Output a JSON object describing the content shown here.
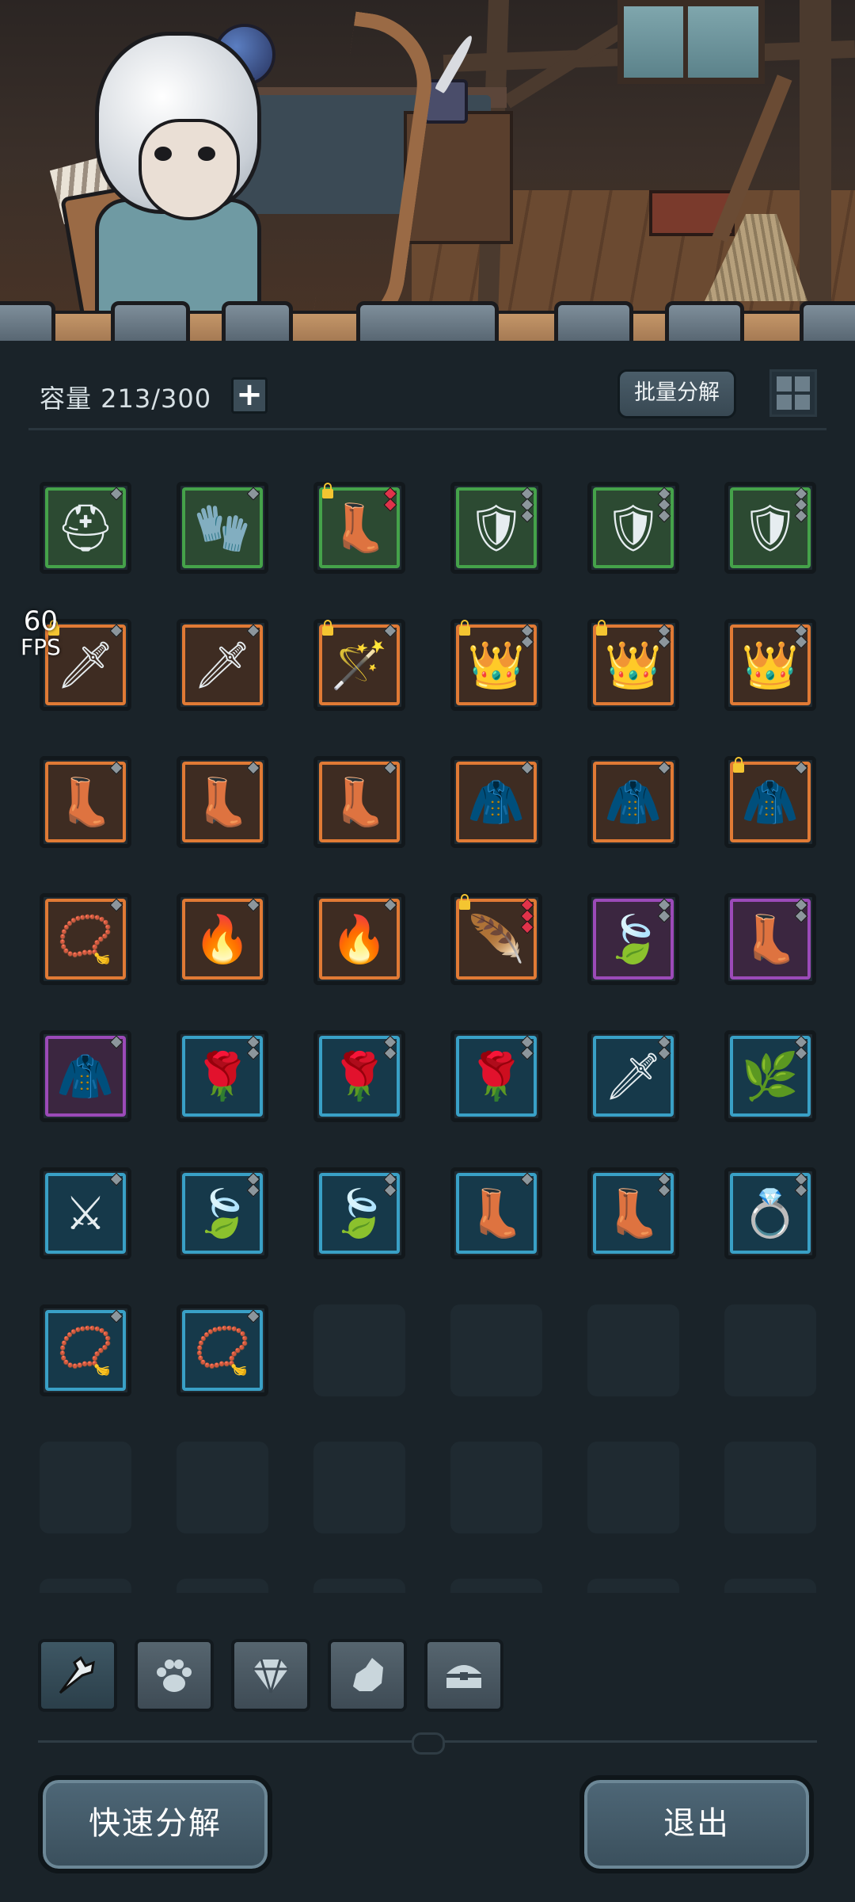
{
  "header": {
    "capacity_label": "容量 213/300",
    "add_capacity_label": "+",
    "batch_decompose_label": "批量分解"
  },
  "fps": {
    "value": "60",
    "label": "FPS"
  },
  "inventory": {
    "columns": 6,
    "items": [
      {
        "name": "white-helmet",
        "quality": "green",
        "icon": "⛑",
        "locked": false,
        "gems": [
          "gray"
        ]
      },
      {
        "name": "purple-gauntlet",
        "quality": "green",
        "icon": "🧤",
        "locked": false,
        "gems": [
          "gray"
        ]
      },
      {
        "name": "purple-boots",
        "quality": "green",
        "icon": "👢",
        "locked": true,
        "gems": [
          "red",
          "red"
        ]
      },
      {
        "name": "purple-armor",
        "quality": "green",
        "icon": "🛡",
        "locked": false,
        "gems": [
          "gray",
          "gray",
          "gray"
        ]
      },
      {
        "name": "purple-armor",
        "quality": "green",
        "icon": "🛡",
        "locked": false,
        "gems": [
          "gray",
          "gray",
          "gray"
        ]
      },
      {
        "name": "purple-armor",
        "quality": "green",
        "icon": "🛡",
        "locked": false,
        "gems": [
          "gray",
          "gray",
          "gray"
        ]
      },
      {
        "name": "crystal-sword",
        "quality": "orange",
        "icon": "🗡",
        "locked": true,
        "gems": [
          "gray"
        ]
      },
      {
        "name": "crystal-sword",
        "quality": "orange",
        "icon": "🗡",
        "locked": false,
        "gems": [
          "gray"
        ]
      },
      {
        "name": "feather-staff",
        "quality": "orange",
        "icon": "🪄",
        "locked": true,
        "gems": [
          "gray"
        ]
      },
      {
        "name": "gold-helmet",
        "quality": "orange",
        "icon": "👑",
        "locked": true,
        "gems": [
          "gray",
          "gray"
        ]
      },
      {
        "name": "gold-helmet",
        "quality": "orange",
        "icon": "👑",
        "locked": true,
        "gems": [
          "gray",
          "gray"
        ]
      },
      {
        "name": "gold-helmet",
        "quality": "orange",
        "icon": "👑",
        "locked": false,
        "gems": [
          "gray",
          "gray"
        ]
      },
      {
        "name": "green-boots",
        "quality": "orange",
        "icon": "👢",
        "locked": false,
        "gems": [
          "gray"
        ]
      },
      {
        "name": "green-boots",
        "quality": "orange",
        "icon": "👢",
        "locked": false,
        "gems": [
          "gray"
        ]
      },
      {
        "name": "green-boots",
        "quality": "orange",
        "icon": "👢",
        "locked": false,
        "gems": [
          "gray"
        ]
      },
      {
        "name": "brown-armor",
        "quality": "orange",
        "icon": "🧥",
        "locked": false,
        "gems": [
          "gray"
        ]
      },
      {
        "name": "brown-armor",
        "quality": "orange",
        "icon": "🧥",
        "locked": false,
        "gems": [
          "gray"
        ]
      },
      {
        "name": "brown-armor",
        "quality": "orange",
        "icon": "🧥",
        "locked": true,
        "gems": [
          "gray"
        ]
      },
      {
        "name": "gold-necklace",
        "quality": "orange",
        "icon": "📿",
        "locked": false,
        "gems": [
          "gray"
        ]
      },
      {
        "name": "flame-amulet",
        "quality": "orange",
        "icon": "🔥",
        "locked": false,
        "gems": [
          "gray"
        ]
      },
      {
        "name": "flame-amulet",
        "quality": "orange",
        "icon": "🔥",
        "locked": false,
        "gems": [
          "gray"
        ]
      },
      {
        "name": "winged-staff",
        "quality": "orange",
        "icon": "🪶",
        "locked": true,
        "gems": [
          "red",
          "red",
          "red"
        ]
      },
      {
        "name": "leaf-gloves",
        "quality": "purple",
        "icon": "🍃",
        "locked": false,
        "gems": [
          "gray",
          "gray"
        ]
      },
      {
        "name": "leather-boots",
        "quality": "purple",
        "icon": "👢",
        "locked": false,
        "gems": [
          "gray",
          "gray"
        ]
      },
      {
        "name": "leaf-armor",
        "quality": "purple",
        "icon": "🧥",
        "locked": false,
        "gems": [
          "gray"
        ]
      },
      {
        "name": "thorn-staff",
        "quality": "blue",
        "icon": "🌹",
        "locked": false,
        "gems": [
          "gray",
          "gray"
        ]
      },
      {
        "name": "thorn-staff",
        "quality": "blue",
        "icon": "🌹",
        "locked": false,
        "gems": [
          "gray",
          "gray"
        ]
      },
      {
        "name": "thorn-staff",
        "quality": "blue",
        "icon": "🌹",
        "locked": false,
        "gems": [
          "gray",
          "gray"
        ]
      },
      {
        "name": "thorn-spear",
        "quality": "blue",
        "icon": "🗡",
        "locked": false,
        "gems": [
          "gray",
          "gray"
        ]
      },
      {
        "name": "thorn-wreath",
        "quality": "blue",
        "icon": "🌿",
        "locked": false,
        "gems": [
          "gray",
          "gray"
        ]
      },
      {
        "name": "dark-sword",
        "quality": "blue",
        "icon": "⚔",
        "locked": false,
        "gems": [
          "gray"
        ]
      },
      {
        "name": "leaf-gloves",
        "quality": "blue",
        "icon": "🍃",
        "locked": false,
        "gems": [
          "gray",
          "gray"
        ]
      },
      {
        "name": "leaf-gloves",
        "quality": "blue",
        "icon": "🍃",
        "locked": false,
        "gems": [
          "gray",
          "gray"
        ]
      },
      {
        "name": "leather-boots",
        "quality": "blue",
        "icon": "👢",
        "locked": false,
        "gems": [
          "gray"
        ]
      },
      {
        "name": "leather-boots",
        "quality": "blue",
        "icon": "👢",
        "locked": false,
        "gems": [
          "gray",
          "gray"
        ]
      },
      {
        "name": "thorn-ring",
        "quality": "blue",
        "icon": "💍",
        "locked": false,
        "gems": [
          "gray",
          "gray"
        ]
      },
      {
        "name": "ruby-necklace",
        "quality": "blue",
        "icon": "📿",
        "locked": false,
        "gems": [
          "gray"
        ]
      },
      {
        "name": "ruby-necklace",
        "quality": "blue",
        "icon": "📿",
        "locked": false,
        "gems": [
          "gray"
        ]
      }
    ],
    "empty_slots_visible": 16
  },
  "tabs": [
    {
      "name": "tab-equipment",
      "icon": "weapon-icon",
      "active": true
    },
    {
      "name": "tab-pets",
      "icon": "paw-icon",
      "active": false
    },
    {
      "name": "tab-gems",
      "icon": "gem-icon",
      "active": false
    },
    {
      "name": "tab-materials",
      "icon": "ore-icon",
      "active": false
    },
    {
      "name": "tab-chests",
      "icon": "chest-icon",
      "active": false
    }
  ],
  "footer": {
    "quick_decompose_label": "快速分解",
    "exit_label": "退出"
  },
  "colors": {
    "green": "#45a24a",
    "orange": "#e07a35",
    "purple": "#9b4ab8",
    "blue": "#39a0c6",
    "background": "#1a2329"
  }
}
